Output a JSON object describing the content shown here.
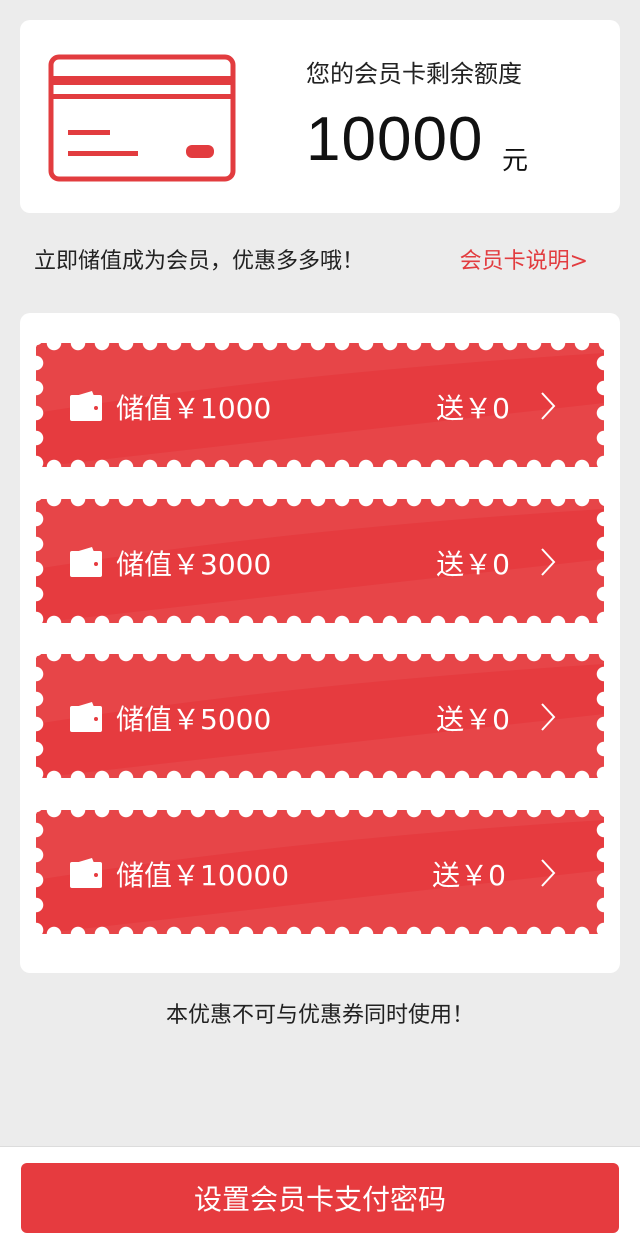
{
  "balance": {
    "label": "您的会员卡剩余额度",
    "amount": "10000",
    "unit": "元",
    "icon": "credit-card-icon"
  },
  "promo": {
    "text": "立即储值成为会员，优惠多多哦！",
    "link_label": "会员卡说明>"
  },
  "tickets": [
    {
      "label": "储值￥1000",
      "bonus": "送￥0"
    },
    {
      "label": "储值￥3000",
      "bonus": "送￥0"
    },
    {
      "label": "储值￥5000",
      "bonus": "送￥0"
    },
    {
      "label": "储值￥10000",
      "bonus": "送￥0"
    }
  ],
  "notice": "本优惠不可与优惠券同时使用！",
  "footer": {
    "button_label": "设置会员卡支付密码"
  },
  "colors": {
    "accent": "#e63b3f",
    "background": "#ececec",
    "card": "#ffffff"
  }
}
